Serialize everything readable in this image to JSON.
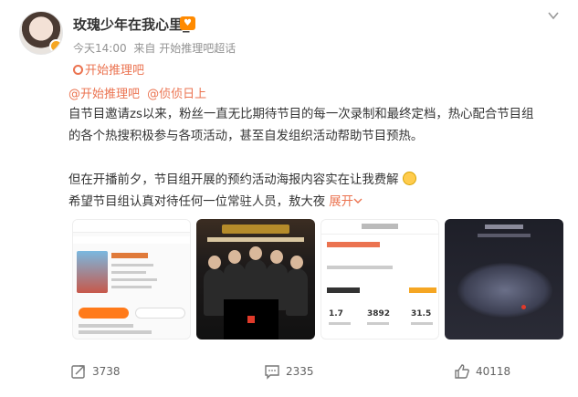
{
  "post": {
    "author": "玫瑰少年在我心里_",
    "time": "今天14:00",
    "source": "来自 开始推理吧超话",
    "supertopic": "开始推理吧",
    "mentions": [
      "@开始推理吧",
      "@侦侦日上"
    ],
    "body_lines": [
      "自节目邀请zs以来，粉丝一直无比期待节目的每一次录制和最终定档，热心配合节目组",
      "的各个热搜积极参与各项活动，甚至自发组织活动帮助节目预热。",
      "但在开播前夕，节目组开展的预约活动海报内容实在让我费解",
      "希望节目组认真对待任何一位常驻人员，敖大夜"
    ],
    "expand_label": "展开",
    "expand_icon": "chevron-down-icon"
  },
  "thumbnails": {
    "t1_title": "开始推理吧",
    "t3_tag": "#高深开始推理吧#",
    "t3_stats": [
      "1.7",
      "3892",
      "31.5"
    ]
  },
  "actions": {
    "repost_count": "3738",
    "comment_count": "2335",
    "like_count": "40118"
  },
  "colors": {
    "accent": "#eb7350",
    "text": "#333333",
    "meta": "#939393",
    "vip": "#ff8a00"
  }
}
